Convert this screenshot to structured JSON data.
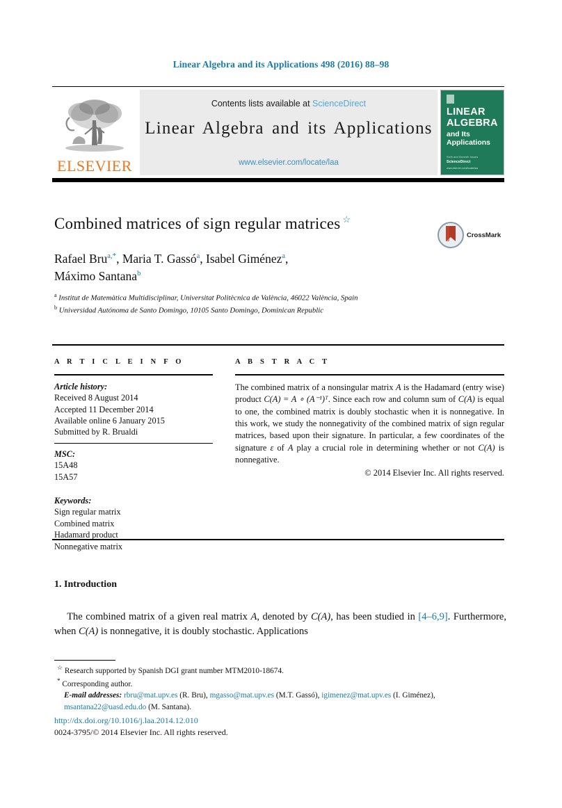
{
  "running_head": "Linear Algebra and its Applications 498 (2016) 88–98",
  "masthead": {
    "publisher_logo_label": "ELSEVIER",
    "contents_prefix": "Contents lists available at",
    "contents_link": "ScienceDirect",
    "journal_title": "Linear Algebra and its Applications",
    "journal_url": "www.elsevier.com/locate/laa",
    "cover": {
      "line1": "LINEAR",
      "line2": "ALGEBRA",
      "line3": "and Its",
      "line4": "Applications",
      "foot1": "Sixth and Seventh Issues",
      "foot2": "ScienceDirect",
      "foot3": "www.elsevier.com/locate/laa",
      "bg_color": "#1f7a5a"
    }
  },
  "article": {
    "title": "Combined matrices of sign regular matrices",
    "title_footnote_mark": "☆",
    "crossmark_label": "CrossMark",
    "authors_line1": "Rafael Bru",
    "authors_line1_sup": "a,",
    "authors_line1_star": "*",
    "author2": "Maria T. Gassó",
    "author2_sup": "a",
    "author3": "Isabel Giménez",
    "author3_sup": "a",
    "author4": "Máximo Santana",
    "author4_sup": "b",
    "affiliations": [
      {
        "mark": "a",
        "text": "Institut de Matemàtica Multidisciplinar, Universitat Politècnica de València, 46022 València, Spain"
      },
      {
        "mark": "b",
        "text": "Universidad Autónoma de Santo Domingo, 10105 Santo Domingo, Dominican Republic"
      }
    ]
  },
  "article_info": {
    "heading": "A R T I C L E   I N F O",
    "history_label": "Article history:",
    "history": [
      "Received 8 August 2014",
      "Accepted 11 December 2014",
      "Available online 6 January 2015",
      "Submitted by R. Brualdi"
    ],
    "msc_label": "MSC:",
    "msc": [
      "15A48",
      "15A57"
    ],
    "keywords_label": "Keywords:",
    "keywords": [
      "Sign regular matrix",
      "Combined matrix",
      "Hadamard product",
      "Nonnegative matrix"
    ]
  },
  "abstract": {
    "heading": "A B S T R A C T",
    "text_part1": "The combined matrix of a nonsingular matrix ",
    "var_A_1": "A",
    "text_part2": " is the Hadamard (entry wise) product ",
    "formula": "C(A) = A ∘ (A⁻¹)ᵀ",
    "text_part3": ". Since each row and column sum of ",
    "formula2": "C(A)",
    "text_part4": " is equal to one, the combined matrix is doubly stochastic when it is nonnegative. In this work, we study the nonnegativity of the combined matrix of sign regular matrices, based upon their signature. In particular, a few coordinates of the signature ",
    "var_eps": "ε",
    "text_part5": " of ",
    "var_A_2": "A",
    "text_part6": " play a crucial role in determining whether or not ",
    "formula3": "C(A)",
    "text_part7": " is nonnegative.",
    "copyright": "© 2014 Elsevier Inc. All rights reserved."
  },
  "introduction": {
    "heading": "1.  Introduction",
    "body_a": "The combined matrix of a given real matrix ",
    "body_var_A": "A",
    "body_b": ", denoted by ",
    "body_CA": "C(A)",
    "body_c": ", has been studied in ",
    "ref_link": "[4–6,9]",
    "body_d": ". Furthermore, when ",
    "body_CA2": "C(A)",
    "body_e": " is nonnegative, it is doubly stochastic. Applications"
  },
  "footnotes": {
    "star_mark": "☆",
    "star_text": "Research supported by Spanish DGI grant number MTM2010-18674.",
    "asterisk_mark": "*",
    "asterisk_text": "Corresponding author.",
    "email_label": "E-mail addresses:",
    "emails": [
      {
        "address": "rbru@mat.upv.es",
        "owner": "(R. Bru),"
      },
      {
        "address": "mgasso@mat.upv.es",
        "owner": "(M.T. Gassó),"
      },
      {
        "address": "igimenez@mat.upv.es",
        "owner": "(I. Giménez),"
      },
      {
        "address": "msantana22@uasd.edu.do",
        "owner": "(M. Santana)."
      }
    ]
  },
  "footer": {
    "doi": "http://dx.doi.org/10.1016/j.laa.2014.12.010",
    "issn_copyright": "0024-3795/© 2014 Elsevier Inc. All rights reserved."
  },
  "colors": {
    "link_blue": "#1a7ba8",
    "sciencedirect_blue": "#4fa8d8",
    "elsevier_orange": "#e87722",
    "cover_green": "#1f7a5a"
  }
}
